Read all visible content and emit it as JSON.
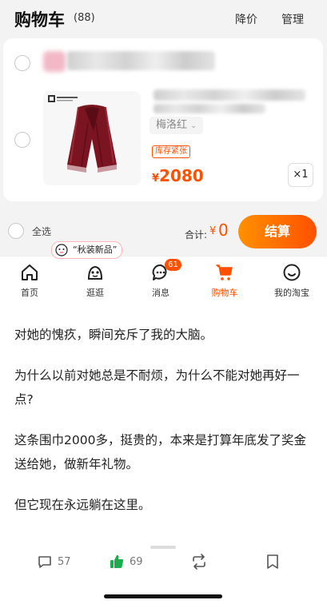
{
  "cart": {
    "title": "购物车",
    "count": "(88)",
    "price_drop_label": "降价",
    "manage_label": "管理",
    "item": {
      "variant": "梅洛红",
      "stock_tag": "库存紧张",
      "currency": "¥",
      "price": "2080",
      "quantity": "×1"
    },
    "select_all_label": "全选",
    "total_label": "合计:",
    "total_currency": "¥",
    "total_value": "0",
    "checkout_label": "结算"
  },
  "promo_bubble": "“秋装新品”",
  "tabbar": {
    "items": [
      {
        "label": "首页",
        "icon": "home-icon"
      },
      {
        "label": "逛逛",
        "icon": "explore-icon"
      },
      {
        "label": "消息",
        "icon": "message-icon",
        "badge": "61"
      },
      {
        "label": "购物车",
        "icon": "cart-icon",
        "active": true
      },
      {
        "label": "我的淘宝",
        "icon": "profile-icon"
      }
    ]
  },
  "article": {
    "paragraphs": [
      "对她的愧疚，瞬间充斥了我的大脑。",
      "为什么以前对她总是不耐烦，为什么不能对她再好一点?",
      "这条围巾2000多，挺贵的，本来是打算年底发了奖金送给她，做新年礼物。",
      "但它现在永远躺在这里。"
    ]
  },
  "actions": {
    "comments": "57",
    "likes": "69"
  },
  "colors": {
    "accent": "#ff5000",
    "like_green": "#1aad4b"
  }
}
